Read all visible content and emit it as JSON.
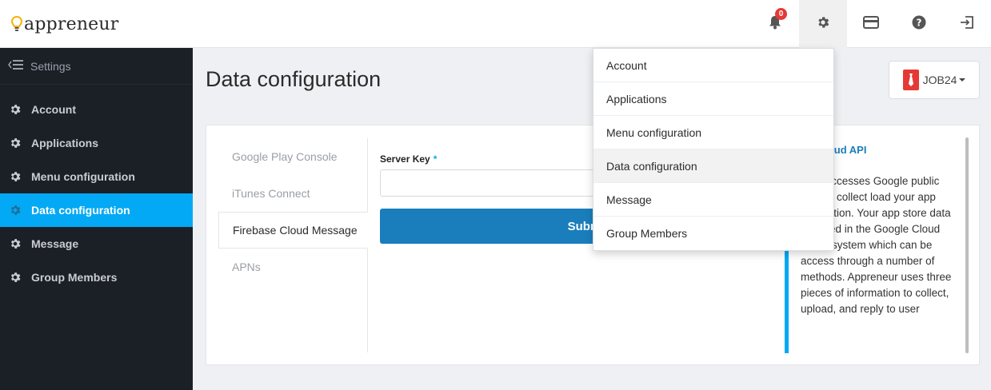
{
  "brand": {
    "name": "appreneur"
  },
  "header": {
    "notifications_count": "0",
    "icons": [
      "bell-icon",
      "gear-icon",
      "credit-card-icon",
      "help-icon",
      "logout-icon"
    ]
  },
  "sidebar": {
    "title": "Settings",
    "items": [
      {
        "label": "Account"
      },
      {
        "label": "Applications"
      },
      {
        "label": "Menu configuration"
      },
      {
        "label": "Data configuration",
        "active": true
      },
      {
        "label": "Message"
      },
      {
        "label": "Group Members"
      }
    ]
  },
  "main": {
    "title": "Data configuration",
    "app_switch": {
      "label": "JOB24"
    },
    "tabs": [
      {
        "label": "Google Play Console"
      },
      {
        "label": "iTunes Connect"
      },
      {
        "label": "Firebase Cloud Message",
        "active": true
      },
      {
        "label": "APNs"
      }
    ],
    "form": {
      "server_key_label": "Server Key",
      "required_mark": "*",
      "server_key_value": "",
      "submit_label": "Submit"
    },
    "info": {
      "title": "e Cloud API",
      "body": "neur accesses Google public data to collect load your app store ation.  Your app store data is stored in the Google Cloud public system which can be access through a number of methods. Appreneur uses three pieces of information to collect, upload, and reply to user"
    }
  },
  "dropdown": {
    "items": [
      {
        "label": "Account"
      },
      {
        "label": "Applications"
      },
      {
        "label": "Menu configuration"
      },
      {
        "label": "Data configuration",
        "active": true
      },
      {
        "label": "Message"
      },
      {
        "label": "Group Members"
      }
    ]
  },
  "colors": {
    "accent": "#03a9f4",
    "primary_button": "#1a7ebc",
    "sidebar_bg": "#1b1f26",
    "badge": "#e53935"
  }
}
